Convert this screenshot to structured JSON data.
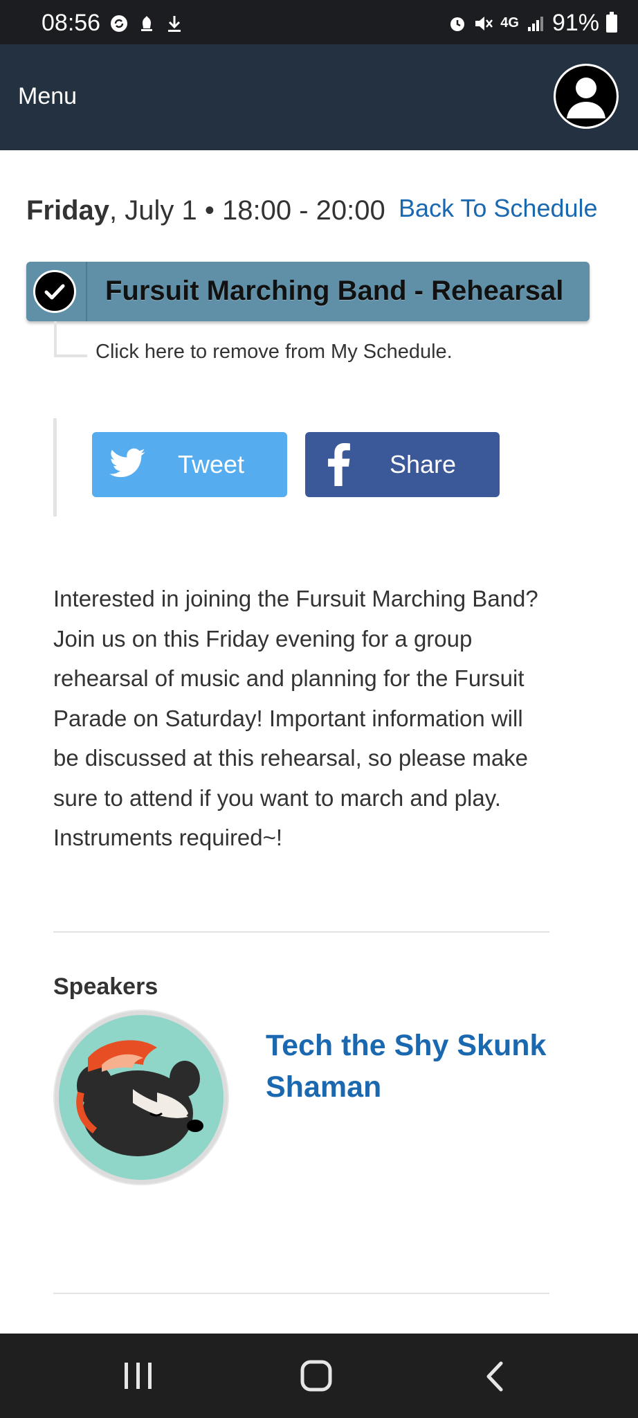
{
  "status_bar": {
    "time": "08:56",
    "battery": "91%",
    "network": "4G",
    "left_icons": [
      "sync-icon",
      "notification-icon",
      "download-icon"
    ],
    "right_icons": [
      "alarm-icon",
      "mute-icon",
      "network-icon",
      "signal-icon",
      "battery-icon"
    ]
  },
  "nav": {
    "menu_label": "Menu"
  },
  "event": {
    "day": "Friday",
    "date_time": ", July 1 • 18:00 - 20:00",
    "back_link": "Back To Schedule",
    "title": "Fursuit Marching Band - Rehearsal",
    "in_schedule": true,
    "remove_note": "Click here to remove from My Schedule.",
    "description": "Interested in joining the Fursuit Marching Band? Join us on this Friday evening for a group rehearsal of music and planning for the Fursuit Parade on Saturday! Important information will be discussed at this rehearsal, so please make sure to attend if you want to march and play. Instruments required~!"
  },
  "share": {
    "tweet_label": "Tweet",
    "share_label": "Share"
  },
  "speakers": {
    "heading": "Speakers",
    "items": [
      {
        "name": "Tech the Shy Skunk Shaman"
      }
    ]
  },
  "colors": {
    "topnav": "#233140",
    "event_bar": "#5f90a8",
    "link": "#1a68b0",
    "twitter": "#55acee",
    "facebook": "#3b5998"
  },
  "system_nav": [
    "recents-button",
    "home-button",
    "back-button"
  ]
}
